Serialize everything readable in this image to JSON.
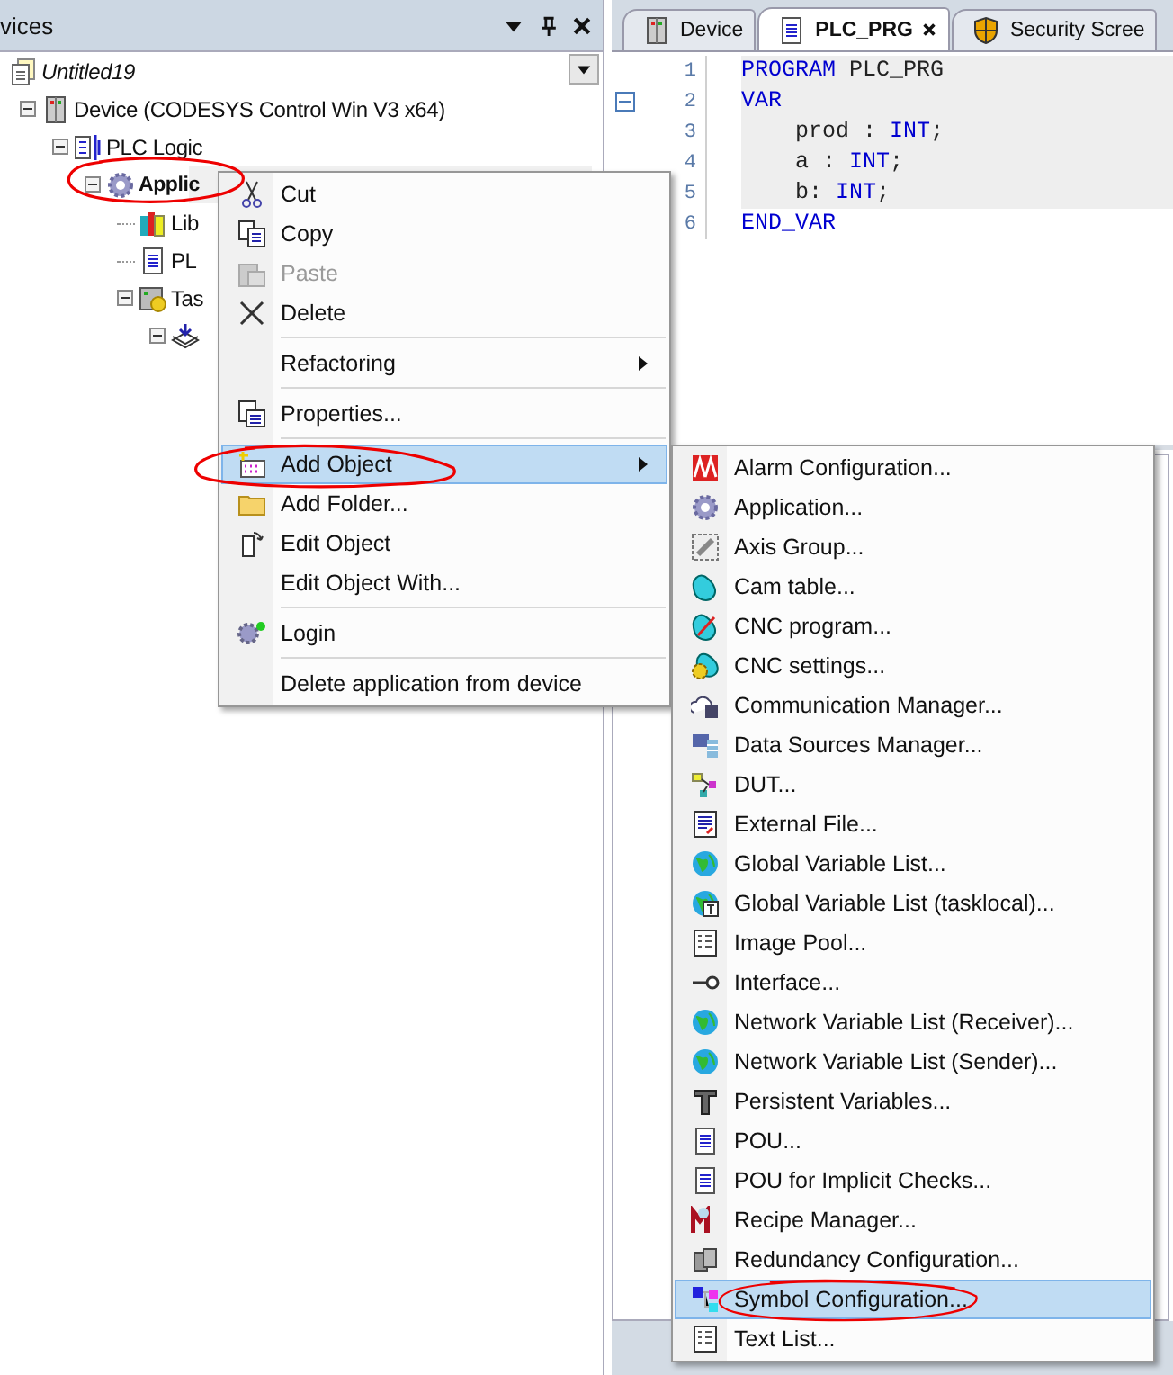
{
  "devices_panel": {
    "title": "vices",
    "tree": [
      {
        "label": "Untitled19",
        "kind": "project",
        "italic": true,
        "bold": false,
        "selected": false,
        "circled": false,
        "children": [
          {
            "label": "Device (CODESYS Control Win V3 x64)",
            "kind": "device",
            "italic": false,
            "bold": false,
            "selected": false,
            "circled": false,
            "expanded": true,
            "children": [
              {
                "label": "PLC Logic",
                "kind": "plc",
                "italic": false,
                "bold": false,
                "selected": false,
                "circled": false,
                "expanded": true,
                "children": [
                  {
                    "label": "Applic",
                    "kind": "application",
                    "italic": false,
                    "bold": true,
                    "selected": true,
                    "circled": true,
                    "expanded": true,
                    "children": [
                      {
                        "label": "Lib",
                        "kind": "library",
                        "italic": false,
                        "bold": false,
                        "selected": false,
                        "circled": false
                      },
                      {
                        "label": "PL",
                        "kind": "pou",
                        "italic": false,
                        "bold": false,
                        "selected": false,
                        "circled": false
                      },
                      {
                        "label": "Tas",
                        "kind": "task",
                        "italic": false,
                        "bold": false,
                        "selected": false,
                        "circled": false,
                        "expanded": true,
                        "children": [
                          {
                            "kind": "task-item",
                            "selected": false,
                            "circled": false,
                            "expanded": true
                          }
                        ]
                      }
                    ]
                  }
                ]
              }
            ]
          }
        ]
      }
    ]
  },
  "editor": {
    "tabs": [
      {
        "label": "Device",
        "kind": "device",
        "selected": false,
        "closable": false
      },
      {
        "label": "PLC_PRG",
        "kind": "pou",
        "selected": true,
        "closable": true
      },
      {
        "label": "Security Scree",
        "kind": "security",
        "selected": false,
        "closable": false
      }
    ],
    "lines": [
      {
        "number": "1",
        "highlighted": true,
        "foldable": false,
        "tokens": [
          {
            "text": "PROGRAM",
            "kind": "keyword"
          },
          {
            "text": " PLC_PRG",
            "kind": "plain"
          }
        ]
      },
      {
        "number": "2",
        "highlighted": true,
        "foldable": true,
        "tokens": [
          {
            "text": "VAR",
            "kind": "keyword"
          }
        ]
      },
      {
        "number": "3",
        "highlighted": true,
        "tokens": [
          {
            "text": "    prod : ",
            "kind": "plain"
          },
          {
            "text": "INT",
            "kind": "keyword"
          },
          {
            "text": ";",
            "kind": "plain"
          }
        ]
      },
      {
        "number": "4",
        "highlighted": true,
        "tokens": [
          {
            "text": "    a : ",
            "kind": "plain"
          },
          {
            "text": "INT",
            "kind": "keyword"
          },
          {
            "text": ";",
            "kind": "plain"
          }
        ]
      },
      {
        "number": "5",
        "highlighted": true,
        "tokens": [
          {
            "text": "    b: ",
            "kind": "plain"
          },
          {
            "text": "INT",
            "kind": "keyword"
          },
          {
            "text": ";",
            "kind": "plain"
          }
        ]
      },
      {
        "number": "6",
        "highlighted": false,
        "tokens": [
          {
            "text": "END_VAR",
            "kind": "keyword"
          }
        ]
      }
    ]
  },
  "context_menu": {
    "items": [
      {
        "kind": "cut",
        "label": "Cut",
        "disabled": false,
        "selected": false,
        "submenu": false,
        "circled": false
      },
      {
        "kind": "copy",
        "label": "Copy",
        "disabled": false,
        "selected": false,
        "submenu": false,
        "circled": false
      },
      {
        "kind": "paste",
        "label": "Paste",
        "disabled": true,
        "selected": false,
        "submenu": false,
        "circled": false
      },
      {
        "kind": "delete",
        "label": "Delete",
        "disabled": false,
        "selected": false,
        "submenu": false,
        "circled": false
      },
      {
        "kind": "separator"
      },
      {
        "kind": "plain",
        "label": "Refactoring",
        "disabled": false,
        "selected": false,
        "submenu": true,
        "circled": false
      },
      {
        "kind": "separator"
      },
      {
        "kind": "properties",
        "label": "Properties...",
        "disabled": false,
        "selected": false,
        "submenu": false,
        "circled": false
      },
      {
        "kind": "separator"
      },
      {
        "kind": "add",
        "label": "Add Object",
        "disabled": false,
        "selected": true,
        "submenu": true,
        "circled": true
      },
      {
        "kind": "folder",
        "label": "Add Folder...",
        "disabled": false,
        "selected": false,
        "submenu": false,
        "circled": false
      },
      {
        "kind": "edit",
        "label": "Edit Object",
        "disabled": false,
        "selected": false,
        "submenu": false,
        "circled": false
      },
      {
        "kind": "plain",
        "label": "Edit Object With...",
        "disabled": false,
        "selected": false,
        "submenu": false,
        "circled": false
      },
      {
        "kind": "separator"
      },
      {
        "kind": "login",
        "label": "Login",
        "disabled": false,
        "selected": false,
        "submenu": false,
        "circled": false
      },
      {
        "kind": "separator"
      },
      {
        "kind": "plain",
        "label": "Delete application from device",
        "disabled": false,
        "selected": false,
        "submenu": false,
        "circled": false
      }
    ]
  },
  "add_object_menu": {
    "items": [
      {
        "kind": "alarm",
        "label": "Alarm Configuration...",
        "selected": false,
        "circled": false
      },
      {
        "kind": "gear",
        "label": "Application...",
        "selected": false,
        "circled": false
      },
      {
        "kind": "axis",
        "label": "Axis Group...",
        "selected": false,
        "circled": false
      },
      {
        "kind": "cam",
        "label": "Cam table...",
        "selected": false,
        "circled": false
      },
      {
        "kind": "cnc",
        "label": "CNC program...",
        "selected": false,
        "circled": false
      },
      {
        "kind": "cnc-settings",
        "label": "CNC settings...",
        "selected": false,
        "circled": false
      },
      {
        "kind": "comm",
        "label": "Communication Manager...",
        "selected": false,
        "circled": false
      },
      {
        "kind": "datasource",
        "label": "Data Sources Manager...",
        "selected": false,
        "circled": false
      },
      {
        "kind": "dut",
        "label": "DUT...",
        "selected": false,
        "circled": false
      },
      {
        "kind": "file",
        "label": "External File...",
        "selected": false,
        "circled": false
      },
      {
        "kind": "globe",
        "label": "Global Variable List...",
        "selected": false,
        "circled": false
      },
      {
        "kind": "globe-t",
        "label": "Global Variable List (tasklocal)...",
        "selected": false,
        "circled": false
      },
      {
        "kind": "list",
        "label": "Image Pool...",
        "selected": false,
        "circled": false
      },
      {
        "kind": "interface",
        "label": "Interface...",
        "selected": false,
        "circled": false
      },
      {
        "kind": "globe",
        "label": "Network Variable List (Receiver)...",
        "selected": false,
        "circled": false
      },
      {
        "kind": "globe",
        "label": "Network Variable List (Sender)...",
        "selected": false,
        "circled": false
      },
      {
        "kind": "persistent",
        "label": "Persistent Variables...",
        "selected": false,
        "circled": false
      },
      {
        "kind": "pou",
        "label": "POU...",
        "selected": false,
        "circled": false
      },
      {
        "kind": "pou",
        "label": "POU for Implicit Checks...",
        "selected": false,
        "circled": false
      },
      {
        "kind": "recipe",
        "label": "Recipe Manager...",
        "selected": false,
        "circled": false
      },
      {
        "kind": "redundancy",
        "label": "Redundancy Configuration...",
        "selected": false,
        "circled": false
      },
      {
        "kind": "symbol",
        "label": "Symbol Configuration...",
        "selected": true,
        "circled": true
      },
      {
        "kind": "list",
        "label": "Text List...",
        "selected": false,
        "circled": false
      }
    ]
  }
}
